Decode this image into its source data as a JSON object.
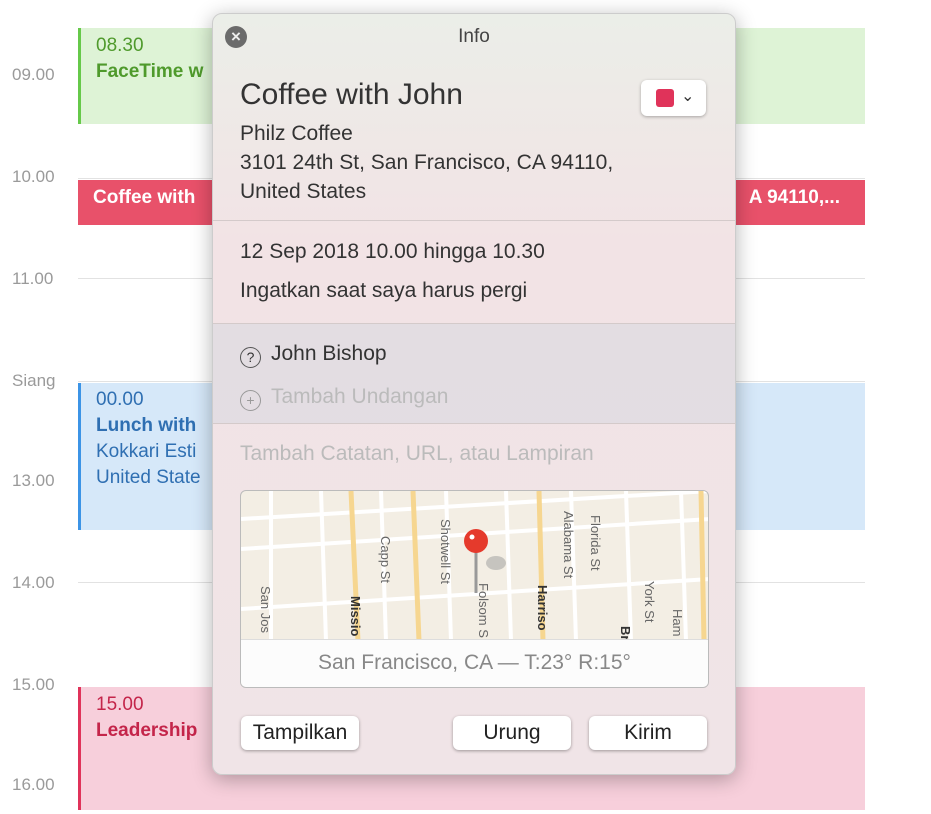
{
  "calendar": {
    "hours": [
      "09.00",
      "10.00",
      "11.00",
      "Siang",
      "13.00",
      "14.00",
      "15.00",
      "16.00"
    ],
    "events": [
      {
        "time": "08.30",
        "title": "FaceTime w",
        "color": "#66c94a"
      },
      {
        "title": "Coffee with",
        "location_tail": "A  94110,...",
        "color": "#e8516a"
      },
      {
        "time": "00.00",
        "title": "Lunch with",
        "line1": "Kokkari Esti",
        "line2": "United State",
        "color": "#3c94e6"
      },
      {
        "time": "15.00",
        "title": "Leadership",
        "color": "#e0335a"
      }
    ]
  },
  "popup": {
    "title": "Info",
    "event_title": "Coffee with John",
    "calendar_color": "#e0335a",
    "location_name": "Philz Coffee",
    "address1": "3101 24th St, San Francisco, CA  94110,",
    "address2": "United States",
    "datetime": "12 Sep 2018  10.00 hingga 10.30",
    "alert": "Ingatkan saat saya harus pergi",
    "invitee": "John Bishop",
    "add_invitee": "Tambah Undangan",
    "notes_placeholder": "Tambah Catatan, URL, atau Lampiran",
    "map": {
      "streets": [
        "San Jos",
        "Missio",
        "Capp St",
        "Shotwell St",
        "Folsom S",
        "Harriso",
        "Alabama St",
        "Florida St",
        "Br",
        "York St",
        "Ham"
      ],
      "caption": "San Francisco, CA — T:23° R:15°"
    },
    "buttons": {
      "show": "Tampilkan",
      "revert": "Urung",
      "send": "Kirim"
    }
  }
}
